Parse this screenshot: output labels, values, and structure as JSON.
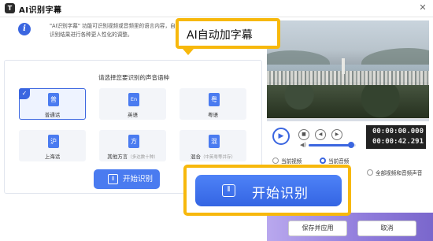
{
  "window": {
    "title": "AI识别字幕",
    "logo_text": "T",
    "close_glyph": "✕"
  },
  "info": {
    "icon": "info-icon",
    "line1": "\"AI识别字幕\" 功能可识别视频或音频里的语言内容，自动",
    "line2": "识别结果进行各种更人性化的调整。"
  },
  "callout_top": {
    "text": "AI自动加字幕"
  },
  "language_panel": {
    "prompt": "请选择您要识别的声音语种",
    "options": [
      {
        "glyph": "普",
        "label": "普通话",
        "sub": "",
        "selected": true
      },
      {
        "glyph": "En",
        "label": "英语",
        "sub": "",
        "selected": false
      },
      {
        "glyph": "粤",
        "label": "粤语",
        "sub": "",
        "selected": false
      },
      {
        "glyph": "沪",
        "label": "上海话",
        "sub": "",
        "selected": false
      },
      {
        "glyph": "方",
        "label": "其他方言",
        "sub": "（多达数十种）",
        "selected": false
      },
      {
        "glyph": "混",
        "label": "混合",
        "sub": "（中英粤等并存）",
        "selected": false
      }
    ],
    "start_small_label": "开始识别"
  },
  "player": {
    "time_current": "00:00:00.000",
    "time_total": "00:00:42.291",
    "volume_fraction": 0.9
  },
  "scope_options": [
    {
      "label": "当前视频",
      "selected": false
    },
    {
      "label": "当前音频",
      "selected": true
    },
    {
      "label": "全部视频和音频声音",
      "selected": false
    }
  ],
  "big_start": {
    "label": "开始识别"
  },
  "footer": {
    "save_label": "保存并应用",
    "cancel_label": "取消"
  },
  "colors": {
    "accent": "#3b66e0",
    "callout_border": "#f7b80c",
    "footer_gradient": "#8f7bdb"
  }
}
